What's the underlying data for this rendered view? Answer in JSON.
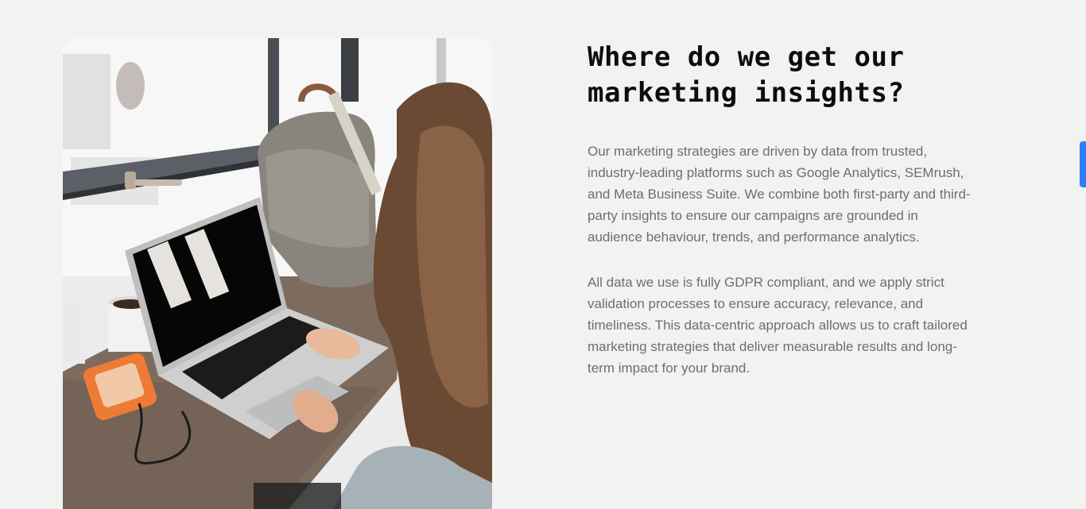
{
  "section": {
    "heading_lines": [
      "Where do we get our",
      "marketing insights?"
    ],
    "paragraph1_lines": [
      "Our marketing strategies are driven by data from trusted,",
      "industry-leading platforms such as Google Analytics, SEMrush,",
      "and Meta Business Suite. We combine both first-party and third-",
      "party insights to ensure our campaigns are grounded in",
      "audience behaviour, trends, and performance analytics."
    ],
    "paragraph2_lines": [
      "All data we use is fully GDPR compliant, and we apply strict",
      "validation processes to ensure accuracy, relevance, and",
      "timeliness. This data-centric approach allows us to craft tailored",
      "marketing strategies that deliver measurable results and long-",
      "term impact for your brand."
    ]
  },
  "image": {
    "subject": "woman-typing-on-laptop-photo"
  },
  "colors": {
    "background": "#f2f2f2",
    "heading": "#0d0d0d",
    "body_text": "#6e6e6e",
    "scrollbar_thumb": "#2f7df6"
  }
}
